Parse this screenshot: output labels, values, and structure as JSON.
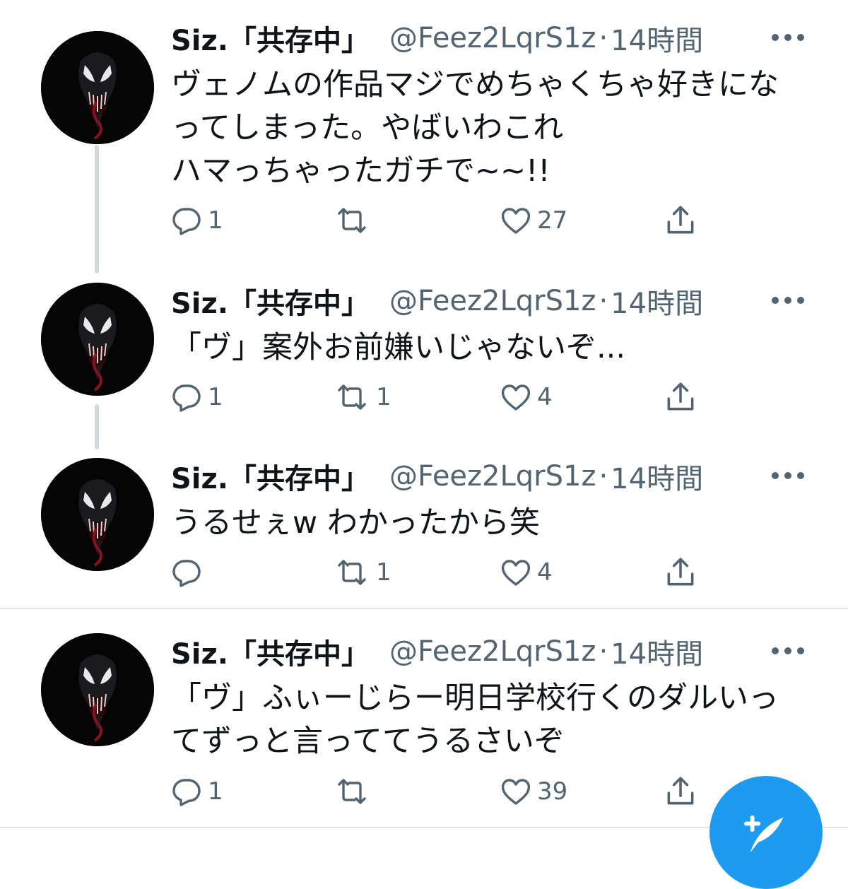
{
  "tweets": [
    {
      "name": "Siz.「共存中」",
      "handle": "@Feez2LqrS1z",
      "time": "14時間",
      "text": "ヴェノムの作品マジでめちゃくちゃ好きにな\nってしまった。やばいわこれ\nハマっちゃったガチで~~!!",
      "replies": "1",
      "retweets": "",
      "likes": "27"
    },
    {
      "name": "Siz.「共存中」",
      "handle": "@Feez2LqrS1z",
      "time": "14時間",
      "text": "「ヴ」案外お前嫌いじゃないぞ...",
      "replies": "1",
      "retweets": "1",
      "likes": "4"
    },
    {
      "name": "Siz.「共存中」",
      "handle": "@Feez2LqrS1z",
      "time": "14時間",
      "text": "うるせぇw わかったから笑",
      "replies": "",
      "retweets": "1",
      "likes": "4"
    },
    {
      "name": "Siz.「共存中」",
      "handle": "@Feez2LqrS1z",
      "time": "14時間",
      "text": "「ヴ」ふぃーじらー明日学校行くのダルいっ\nてずっと言っててうるさいぞ",
      "replies": "1",
      "retweets": "",
      "likes": "39"
    }
  ],
  "separator": "·",
  "icons": {
    "reply": "reply-icon",
    "retweet": "retweet-icon",
    "like": "heart-icon",
    "share": "share-icon",
    "more": "more-icon",
    "compose": "compose-icon",
    "avatar": "venom-avatar"
  },
  "colors": {
    "accent": "#1d9bf0",
    "text": "#0f1419",
    "secondary": "#536471",
    "thread_line": "#cfd9de"
  }
}
